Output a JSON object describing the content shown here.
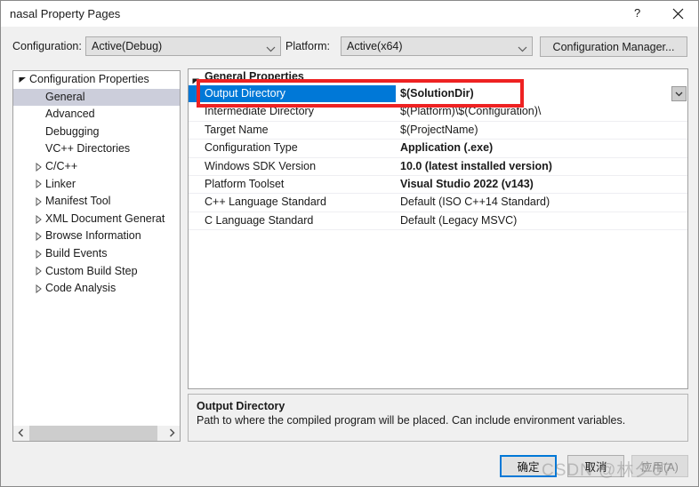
{
  "window": {
    "title": "nasal Property Pages",
    "help_icon": "question-mark-icon",
    "close_icon": "close-icon"
  },
  "toolbar": {
    "configuration_label": "Configuration:",
    "configuration_value": "Active(Debug)",
    "platform_label": "Platform:",
    "platform_value": "Active(x64)",
    "configuration_manager_label": "Configuration Manager..."
  },
  "tree": {
    "items": [
      {
        "label": "Configuration Properties",
        "level": 0,
        "expander": "expanded",
        "selected": false
      },
      {
        "label": "General",
        "level": 1,
        "expander": "none",
        "selected": true
      },
      {
        "label": "Advanced",
        "level": 1,
        "expander": "none",
        "selected": false
      },
      {
        "label": "Debugging",
        "level": 1,
        "expander": "none",
        "selected": false
      },
      {
        "label": "VC++ Directories",
        "level": 1,
        "expander": "none",
        "selected": false
      },
      {
        "label": "C/C++",
        "level": 1,
        "expander": "collapsed",
        "selected": false
      },
      {
        "label": "Linker",
        "level": 1,
        "expander": "collapsed",
        "selected": false
      },
      {
        "label": "Manifest Tool",
        "level": 1,
        "expander": "collapsed",
        "selected": false
      },
      {
        "label": "XML Document Generat",
        "level": 1,
        "expander": "collapsed",
        "selected": false
      },
      {
        "label": "Browse Information",
        "level": 1,
        "expander": "collapsed",
        "selected": false
      },
      {
        "label": "Build Events",
        "level": 1,
        "expander": "collapsed",
        "selected": false
      },
      {
        "label": "Custom Build Step",
        "level": 1,
        "expander": "collapsed",
        "selected": false
      },
      {
        "label": "Code Analysis",
        "level": 1,
        "expander": "collapsed",
        "selected": false
      }
    ],
    "scrollbar": {
      "left_arrow_icon": "chevron-left-icon",
      "right_arrow_icon": "chevron-right-icon"
    }
  },
  "grid": {
    "category": "General Properties",
    "rows": [
      {
        "name": "Output Directory",
        "value": "$(SolutionDir)",
        "bold": true,
        "selected": true,
        "has_dropdown": true
      },
      {
        "name": "Intermediate Directory",
        "value": "$(Platform)\\$(Configuration)\\",
        "bold": false,
        "selected": false,
        "has_dropdown": false
      },
      {
        "name": "Target Name",
        "value": "$(ProjectName)",
        "bold": false,
        "selected": false,
        "has_dropdown": false
      },
      {
        "name": "Configuration Type",
        "value": "Application (.exe)",
        "bold": true,
        "selected": false,
        "has_dropdown": false
      },
      {
        "name": "Windows SDK Version",
        "value": "10.0 (latest installed version)",
        "bold": true,
        "selected": false,
        "has_dropdown": false
      },
      {
        "name": "Platform Toolset",
        "value": "Visual Studio 2022 (v143)",
        "bold": true,
        "selected": false,
        "has_dropdown": false
      },
      {
        "name": "C++ Language Standard",
        "value": "Default (ISO C++14 Standard)",
        "bold": false,
        "selected": false,
        "has_dropdown": false
      },
      {
        "name": "C Language Standard",
        "value": "Default (Legacy MSVC)",
        "bold": false,
        "selected": false,
        "has_dropdown": false
      }
    ]
  },
  "description": {
    "title": "Output Directory",
    "body": "Path to where the compiled program will be placed. Can include environment variables."
  },
  "footer": {
    "ok_label": "确定",
    "cancel_label": "取消",
    "apply_label": "应用(A)"
  },
  "annotation": {
    "color": "#ee2222"
  },
  "watermark": {
    "text": "CSDN @林夕07"
  }
}
